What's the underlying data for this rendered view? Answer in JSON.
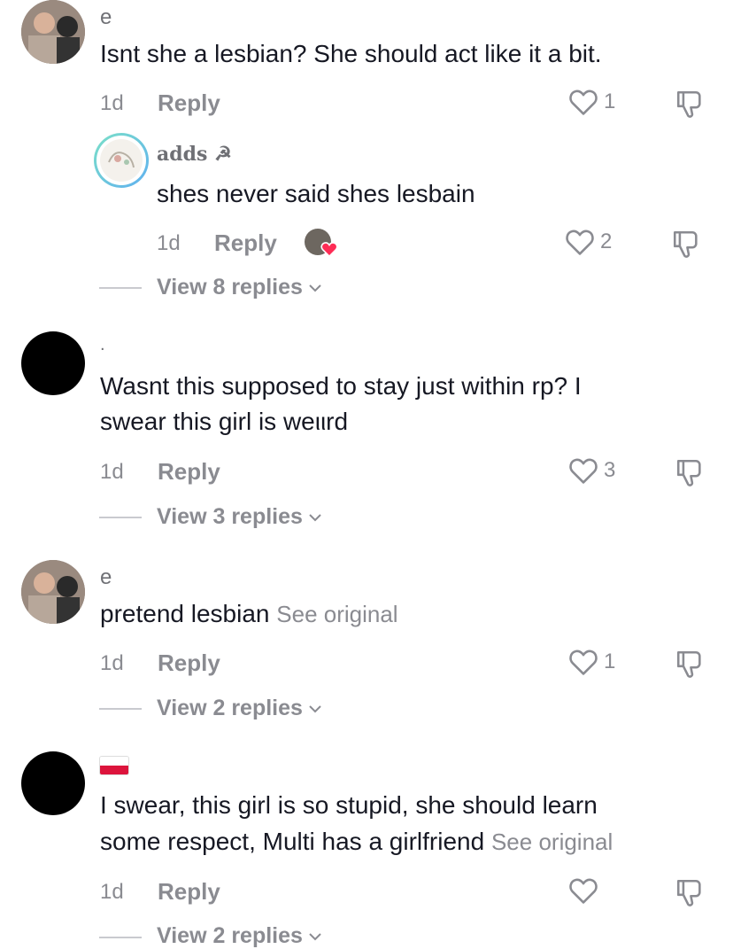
{
  "comments": [
    {
      "username": "e",
      "text": "Isnt she a lesbian? She should act like it a bit.",
      "time": "1d",
      "reply_label": "Reply",
      "likes": "1",
      "avatar": "couple-photo"
    },
    {
      "username": "adds ☭",
      "text": "shes never said shes lesbain",
      "time": "1d",
      "reply_label": "Reply",
      "likes": "2",
      "avatar": "drawing-ring",
      "view_replies": "View 8 replies"
    },
    {
      "username": ".",
      "text_line1": "Wasnt this supposed to stay just within rp? I",
      "text_line2": "swear this girl is weιιrd",
      "time": "1d",
      "reply_label": "Reply",
      "likes": "3",
      "avatar": "black",
      "view_replies": "View 3 replies"
    },
    {
      "username": "e",
      "text": "pretend lesbian",
      "see_original": "See original",
      "time": "1d",
      "reply_label": "Reply",
      "likes": "1",
      "avatar": "couple-photo",
      "view_replies": "View 2 replies"
    },
    {
      "username_flag": "flag-poland-icon",
      "text_line1": "I swear, this girl is so stupid, she should learn",
      "text_line2": "some respect, Multi has a girlfriend",
      "see_original": "See original",
      "time": "1d",
      "reply_label": "Reply",
      "likes": "",
      "avatar": "black",
      "view_replies": "View 2 replies"
    }
  ],
  "colors": {
    "text": "#161823",
    "muted": "#8a8b91",
    "line": "#c9cacf"
  }
}
